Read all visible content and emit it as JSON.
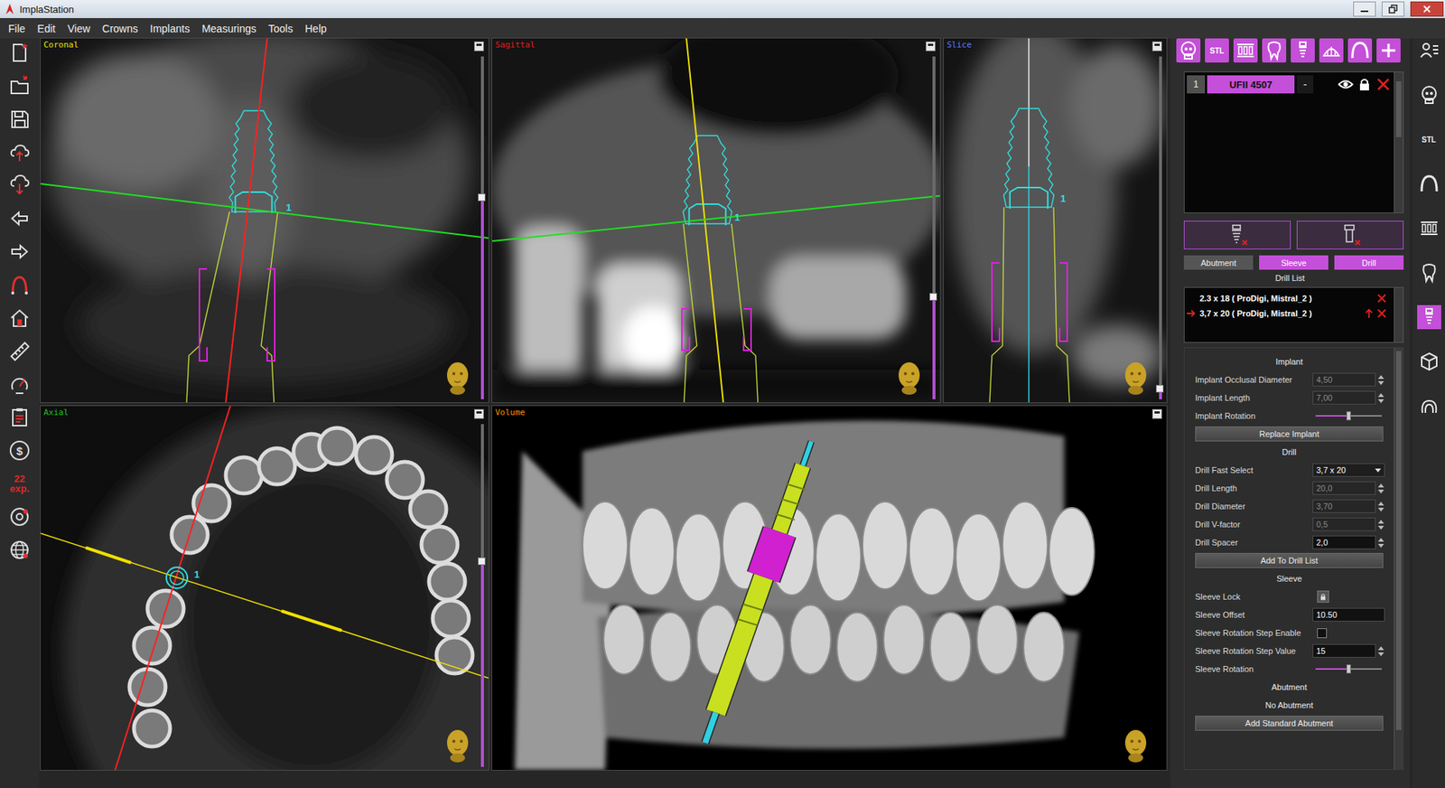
{
  "window": {
    "title": "ImplaStation"
  },
  "menu": [
    "File",
    "Edit",
    "View",
    "Crowns",
    "Implants",
    "Measurings",
    "Tools",
    "Help"
  ],
  "left_toolbar": [
    {
      "kind": "icon"
    },
    {
      "kind": "icon"
    },
    {
      "kind": "icon"
    },
    {
      "kind": "icon"
    },
    {
      "kind": "icon"
    },
    {
      "kind": "icon"
    },
    {
      "kind": "icon"
    },
    {
      "kind": "icon"
    },
    {
      "kind": "icon"
    },
    {
      "kind": "icon"
    },
    {
      "kind": "icon"
    },
    {
      "kind": "icon"
    },
    {
      "kind": "text",
      "label": "$"
    },
    {
      "kind": "counter",
      "count": "22",
      "unit": "exp."
    },
    {
      "kind": "icon"
    },
    {
      "kind": "icon"
    }
  ],
  "views": [
    {
      "label": "Coronal",
      "color": "#e8e800",
      "kind": "slice",
      "level": 0.59,
      "marker": "1"
    },
    {
      "label": "Sagittal",
      "color": "#e02020",
      "kind": "slice",
      "level": 0.3,
      "marker": "1"
    },
    {
      "label": "Slice",
      "color": "#5a7cff",
      "kind": "slice",
      "level": 0.03,
      "marker": "1"
    },
    {
      "label": "Axial",
      "color": "#20c020",
      "kind": "slice",
      "level": 0.6,
      "marker": "1"
    },
    {
      "label": "Volume",
      "color": "#ff8c00",
      "kind": "volume"
    }
  ],
  "top_tools": [
    {
      "kind": "icon"
    },
    {
      "kind": "text",
      "label": "STL"
    },
    {
      "kind": "icon"
    },
    {
      "kind": "icon"
    },
    {
      "kind": "icon"
    },
    {
      "kind": "icon"
    },
    {
      "kind": "icon"
    },
    {
      "kind": "icon"
    }
  ],
  "implants": [
    {
      "number": "1",
      "name": "UFII 4507",
      "toggle": "-",
      "selected": true
    }
  ],
  "mode_tabs": [
    {
      "label": "Abutment",
      "selected": false
    },
    {
      "label": "Sleeve",
      "selected": true
    },
    {
      "label": "Drill",
      "selected": true
    }
  ],
  "drill_list": {
    "title": "Drill List",
    "items": [
      {
        "label": "2.3 x 18 ( ProDigi, Mistral_2 )",
        "selected": false
      },
      {
        "label": "3,7 x 20 ( ProDigi, Mistral_2 )",
        "selected": true
      }
    ]
  },
  "sections": [
    {
      "title": "Implant",
      "rows": [
        {
          "kind": "number",
          "label": "Implant Occlusal Diameter",
          "value": "4,50",
          "disabled": true
        },
        {
          "kind": "number",
          "label": "Implant Length",
          "value": "7,00",
          "disabled": true
        },
        {
          "kind": "slider",
          "label": "Implant Rotation",
          "level": 0.5
        },
        {
          "kind": "button",
          "label": "Replace Implant"
        }
      ]
    },
    {
      "title": "Drill",
      "rows": [
        {
          "kind": "select",
          "label": "Drill Fast Select",
          "value": "3,7 x 20"
        },
        {
          "kind": "number",
          "label": "Drill Length",
          "value": "20,0",
          "disabled": true
        },
        {
          "kind": "number",
          "label": "Drill Diameter",
          "value": "3,70",
          "disabled": true
        },
        {
          "kind": "number",
          "label": "Drill V-factor",
          "value": "0,5",
          "disabled": true
        },
        {
          "kind": "number",
          "label": "Drill Spacer",
          "value": "2,0",
          "disabled": false
        },
        {
          "kind": "button",
          "label": "Add To Drill List"
        }
      ]
    },
    {
      "title": "Sleeve",
      "rows": [
        {
          "kind": "lock",
          "label": "Sleeve Lock"
        },
        {
          "kind": "input",
          "label": "Sleeve Offset",
          "value": "10.50"
        },
        {
          "kind": "checkbox",
          "label": "Sleeve Rotation Step Enable",
          "checked": false
        },
        {
          "kind": "number",
          "label": "Sleeve Rotation Step Value",
          "value": "15",
          "disabled": false
        },
        {
          "kind": "slider",
          "label": "Sleeve Rotation",
          "level": 0.5
        }
      ]
    },
    {
      "title": "Abutment",
      "rows": [
        {
          "kind": "note",
          "label": "No Abutment"
        },
        {
          "kind": "button",
          "label": "Add Standard Abutment"
        }
      ]
    }
  ],
  "side_tabs": [
    {
      "kind": "icon",
      "selected": false
    },
    {
      "kind": "icon",
      "selected": false
    },
    {
      "kind": "text",
      "label": "STL",
      "selected": false
    },
    {
      "kind": "icon",
      "selected": false
    },
    {
      "kind": "icon",
      "selected": false
    },
    {
      "kind": "icon",
      "selected": false
    },
    {
      "kind": "icon",
      "selected": true
    },
    {
      "kind": "icon",
      "selected": false
    },
    {
      "kind": "icon",
      "selected": false
    }
  ]
}
